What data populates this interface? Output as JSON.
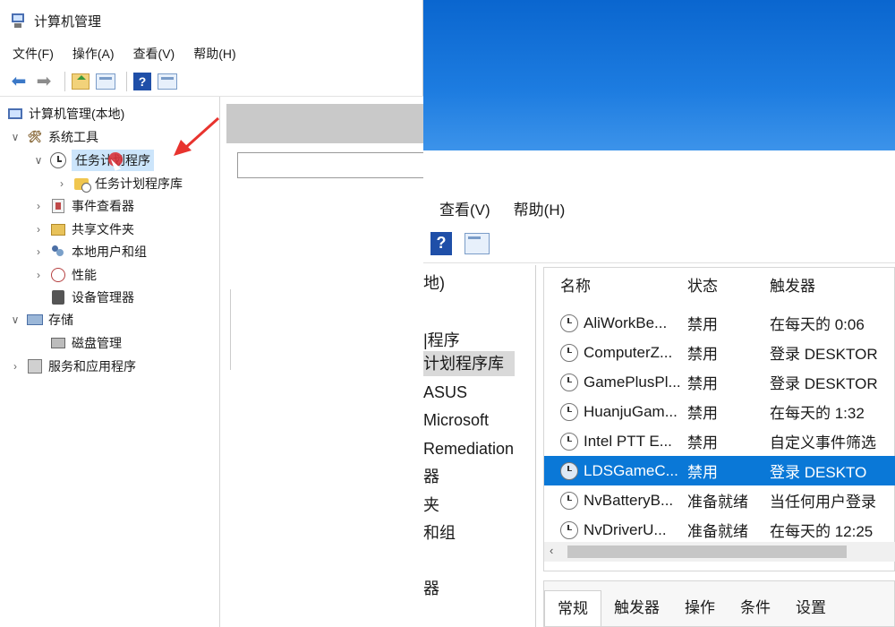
{
  "left_window": {
    "title": "计算机管理",
    "menu": [
      "文件(F)",
      "操作(A)",
      "查看(V)",
      "帮助(H)"
    ],
    "tree": {
      "root": "计算机管理(本地)",
      "system_tools": "系统工具",
      "task_scheduler": "任务计划程序",
      "task_library": "任务计划程序库",
      "event_viewer": "事件查看器",
      "shared_folders": "共享文件夹",
      "local_users": "本地用户和组",
      "performance": "性能",
      "device_manager": "设备管理器",
      "storage": "存储",
      "disk_management": "磁盘管理",
      "services_apps": "服务和应用程序"
    }
  },
  "right_window": {
    "menu": [
      "查看(V)",
      "帮助(H)"
    ],
    "tree_fragments": [
      "地)",
      "|程序",
      "计划程序库",
      "ASUS",
      "Microsoft",
      "Remediation",
      "器",
      "夹",
      "和组",
      "器"
    ],
    "columns": [
      "名称",
      "状态",
      "触发器"
    ],
    "tasks": [
      {
        "name": "AliWorkBe...",
        "status": "禁用",
        "trigger": "在每天的 0:06"
      },
      {
        "name": "ComputerZ...",
        "status": "禁用",
        "trigger": "登录 DESKTOR"
      },
      {
        "name": "GamePlusPl...",
        "status": "禁用",
        "trigger": "登录 DESKTOR"
      },
      {
        "name": "HuanjuGam...",
        "status": "禁用",
        "trigger": "在每天的 1:32"
      },
      {
        "name": "Intel PTT E...",
        "status": "禁用",
        "trigger": "自定义事件筛选"
      },
      {
        "name": "LDSGameC...",
        "status": "禁用",
        "trigger": "登录 DESKTO"
      },
      {
        "name": "NvBatteryB...",
        "status": "准备就绪",
        "trigger": "当任何用户登录"
      },
      {
        "name": "NvDriverU...",
        "status": "准备就绪",
        "trigger": "在每天的 12:25"
      }
    ],
    "selected_task_index": 5,
    "detail_tabs": [
      "常规",
      "触发器",
      "操作",
      "条件",
      "设置"
    ]
  },
  "colors": {
    "selection": "#0a78d7",
    "desktop": "#1d7ce0",
    "annotation_arrow": "#e8332e"
  }
}
